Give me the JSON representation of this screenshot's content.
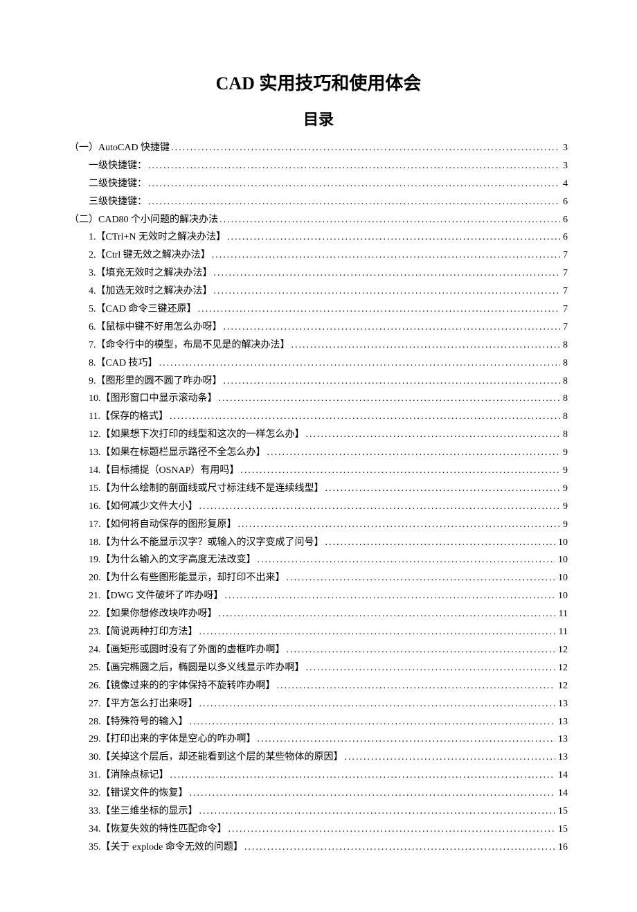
{
  "title": "CAD 实用技巧和使用体会",
  "subtitle": "目录",
  "toc": [
    {
      "level": 1,
      "label": "（一）AutoCAD 快捷键",
      "page": "3"
    },
    {
      "level": 2,
      "label": "一级快捷键：",
      "page": "3"
    },
    {
      "level": 2,
      "label": "二级快捷键：",
      "page": "4"
    },
    {
      "level": 2,
      "label": "三级快捷键：",
      "page": "6"
    },
    {
      "level": 1,
      "label": "（二）CAD80 个小问题的解决办法",
      "page": "6"
    },
    {
      "level": 2,
      "label": "1.【CTrl+N 无效时之解决办法】",
      "page": "6"
    },
    {
      "level": 2,
      "label": "2.【Ctrl 键无效之解决办法】",
      "page": "7"
    },
    {
      "level": 2,
      "label": "3.【填充无效时之解决办法】",
      "page": "7"
    },
    {
      "level": 2,
      "label": "4.【加选无效时之解决办法】",
      "page": "7"
    },
    {
      "level": 2,
      "label": "5.【CAD 命令三键还原】",
      "page": "7"
    },
    {
      "level": 2,
      "label": "6.【鼠标中键不好用怎么办呀】",
      "page": "7"
    },
    {
      "level": 2,
      "label": "7.【命令行中的模型，布局不见是的解决办法】",
      "page": "8"
    },
    {
      "level": 2,
      "label": "8.【CAD 技巧】",
      "page": "8"
    },
    {
      "level": 2,
      "label": "9.【图形里的圆不圆了咋办呀】",
      "page": "8"
    },
    {
      "level": 2,
      "label": "10.【图形窗口中显示滚动条】",
      "page": "8"
    },
    {
      "level": 2,
      "label": "11.【保存的格式】",
      "page": "8"
    },
    {
      "level": 2,
      "label": "12.【如果想下次打印的线型和这次的一样怎么办】",
      "page": "8"
    },
    {
      "level": 2,
      "label": "13.【如果在标题栏显示路径不全怎么办】",
      "page": "9"
    },
    {
      "level": 2,
      "label": "14.【目标捕捉（OSNAP）有用吗】",
      "page": "9"
    },
    {
      "level": 2,
      "label": "15.【为什么绘制的剖面线或尺寸标注线不是连续线型】",
      "page": "9"
    },
    {
      "level": 2,
      "label": "16.【如何减少文件大小】",
      "page": "9"
    },
    {
      "level": 2,
      "label": "17.【如何将自动保存的图形复原】",
      "page": "9"
    },
    {
      "level": 2,
      "label": "18.【为什么不能显示汉字？或输入的汉字变成了问号】",
      "page": "10"
    },
    {
      "level": 2,
      "label": "19.【为什么输入的文字高度无法改变】",
      "page": "10"
    },
    {
      "level": 2,
      "label": "20.【为什么有些图形能显示，却打印不出来】",
      "page": "10"
    },
    {
      "level": 2,
      "label": "21.【DWG 文件破坏了咋办呀】",
      "page": "10"
    },
    {
      "level": 2,
      "label": "22.【如果你想修改块咋办呀】",
      "page": "11"
    },
    {
      "level": 2,
      "label": "23.【简说两种打印方法】",
      "page": "11"
    },
    {
      "level": 2,
      "label": "24.【画矩形或圆时没有了外面的虚框咋办啊】",
      "page": "12"
    },
    {
      "level": 2,
      "label": "25.【画完椭圆之后，椭圆是以多义线显示咋办啊】",
      "page": "12"
    },
    {
      "level": 2,
      "label": "26.【镜像过来的的字体保持不旋转咋办啊】",
      "page": "12"
    },
    {
      "level": 2,
      "label": "27.【平方怎么打出来呀】",
      "page": "13"
    },
    {
      "level": 2,
      "label": "28.【特殊符号的输入】",
      "page": "13"
    },
    {
      "level": 2,
      "label": "29.【打印出来的字体是空心的咋办啊】",
      "page": "13"
    },
    {
      "level": 2,
      "label": "30.【关掉这个层后，却还能看到这个层的某些物体的原因】",
      "page": "13"
    },
    {
      "level": 2,
      "label": "31.【消除点标记】",
      "page": "14"
    },
    {
      "level": 2,
      "label": "32.【错误文件的恢复】",
      "page": "14"
    },
    {
      "level": 2,
      "label": "33.【坐三维坐标的显示】",
      "page": "15"
    },
    {
      "level": 2,
      "label": "34.【恢复失效的特性匹配命令】",
      "page": "15"
    },
    {
      "level": 2,
      "label": "35.【关于 explode 命令无效的问题】",
      "page": "16"
    }
  ]
}
